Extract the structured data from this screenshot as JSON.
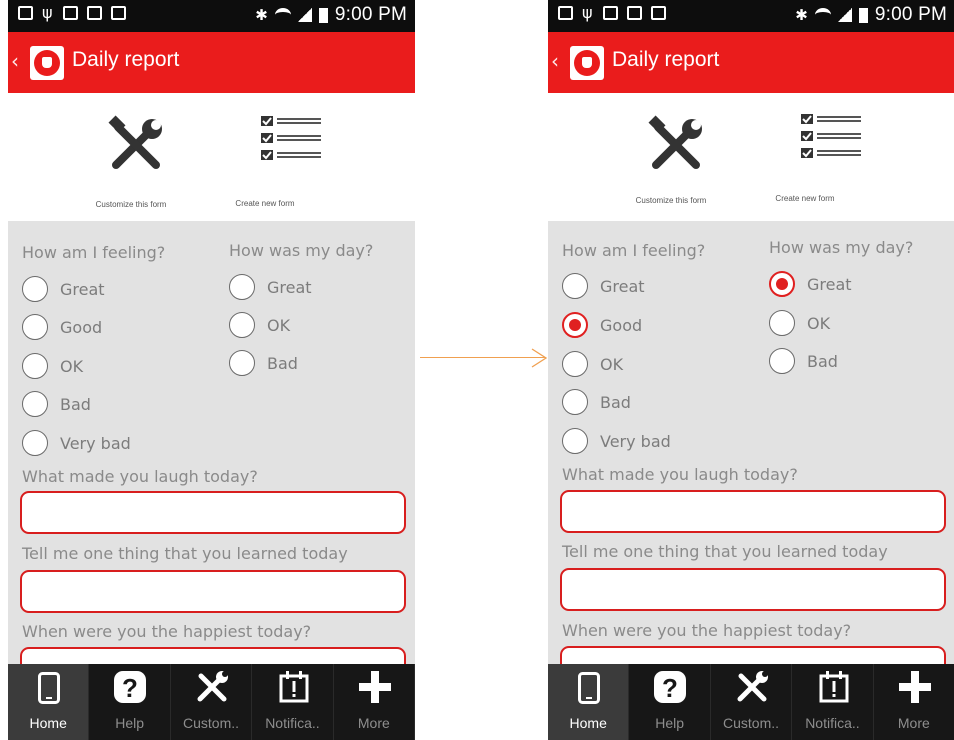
{
  "screens": [
    {
      "statusbar": {
        "time": "9:00 PM",
        "bluetooth": "✱"
      },
      "appbar": {
        "title": "Daily report",
        "back": "‹"
      },
      "quick_actions": {
        "customize_label": "Customize this form",
        "create_label": "Create new form"
      },
      "form": {
        "feeling": {
          "label": "How am I feeling?",
          "options": [
            "Great",
            "Good",
            "OK",
            "Bad",
            "Very bad"
          ],
          "selected": null
        },
        "day": {
          "label": "How was my day?",
          "options": [
            "Great",
            "OK",
            "Bad"
          ],
          "selected": null
        },
        "laugh_label": "What made you laugh today?",
        "learned_label": "Tell me one thing that you learned today",
        "happiest_label": "When were you the happiest today?"
      },
      "nav": [
        "Home",
        "Help",
        "Custom..",
        "Notifica..",
        "More"
      ]
    },
    {
      "statusbar": {
        "time": "9:00 PM",
        "bluetooth": "✱"
      },
      "appbar": {
        "title": "Daily report",
        "back": "‹"
      },
      "quick_actions": {
        "customize_label": "Customize this form",
        "create_label": "Create new form"
      },
      "form": {
        "feeling": {
          "label": "How am I feeling?",
          "options": [
            "Great",
            "Good",
            "OK",
            "Bad",
            "Very bad"
          ],
          "selected": "Good"
        },
        "day": {
          "label": "How was my day?",
          "options": [
            "Great",
            "OK",
            "Bad"
          ],
          "selected": "Great"
        },
        "laugh_label": "What made you laugh today?",
        "learned_label": "Tell me one thing that you learned today",
        "happiest_label": "When were you the happiest today?"
      },
      "nav": [
        "Home",
        "Help",
        "Custom..",
        "Notifica..",
        "More"
      ]
    }
  ],
  "colors": {
    "accent": "#ea1c1c",
    "arrow": "#f0a050",
    "form_bg": "#e2e2e2",
    "nav_bg": "#171717"
  }
}
